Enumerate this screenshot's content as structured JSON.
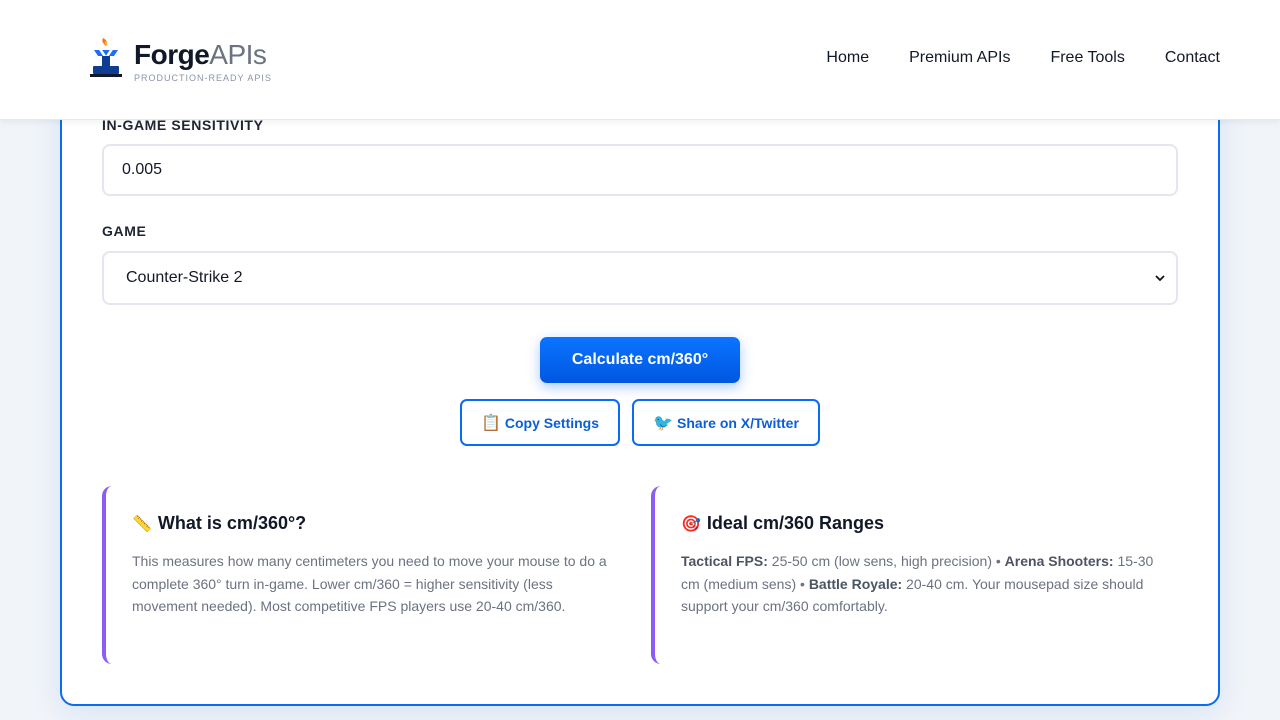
{
  "header": {
    "brand_bold": "Forge",
    "brand_light": "APIs",
    "tagline": "PRODUCTION-READY APIS",
    "nav": [
      "Home",
      "Premium APIs",
      "Free Tools",
      "Contact"
    ]
  },
  "form": {
    "sensitivity_label": "IN-GAME SENSITIVITY",
    "sensitivity_value": "0.005",
    "game_label": "GAME",
    "game_value": "Counter-Strike 2"
  },
  "actions": {
    "calculate_label": "Calculate cm/360°",
    "copy_icon": "📋",
    "copy_label": "Copy Settings",
    "share_icon": "🐦",
    "share_label": "Share on X/Twitter"
  },
  "info_cards": [
    {
      "icon": "📏",
      "title": "What is cm/360°?",
      "body": "This measures how many centimeters you need to move your mouse to do a complete 360° turn in-game. Lower cm/360 = higher sensitivity (less movement needed). Most competitive FPS players use 20-40 cm/360."
    },
    {
      "icon": "🎯",
      "title": "Ideal cm/360 Ranges",
      "tactical_label": "Tactical FPS:",
      "tactical_text": " 25-50 cm (low sens, high precision) • ",
      "arena_label": "Arena Shooters:",
      "arena_text": " 15-30 cm (medium sens) • ",
      "br_label": "Battle Royale:",
      "br_text": " 20-40 cm. Your mousepad size should support your cm/360 comfortably."
    }
  ],
  "colors": {
    "accent": "#0a6cf2",
    "info_border": "#8b5cf6"
  }
}
